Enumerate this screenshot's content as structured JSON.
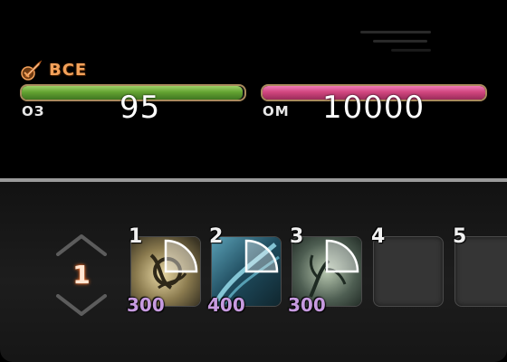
{
  "party_member": {
    "name": "ВСЕ",
    "hp_label": "ОЗ",
    "hp_value": "95",
    "hp_fill": 0.99,
    "mp_label": "ОМ",
    "mp_value": "10000",
    "mp_fill": 1.0,
    "role_icon": "sword-job-icon"
  },
  "colors": {
    "hp": "#64a332",
    "mp": "#d1467f",
    "name": "#f3a15a",
    "cost": "#c79be0"
  },
  "hotbar": {
    "bar_number": "1",
    "slots": [
      {
        "key": "1",
        "cost": "300",
        "icon": "aetherial-skill-icon"
      },
      {
        "key": "2",
        "cost": "400",
        "icon": "water-skill-icon"
      },
      {
        "key": "3",
        "cost": "300",
        "icon": "nature-skill-icon"
      },
      {
        "key": "4",
        "cost": "",
        "icon": "empty-slot"
      },
      {
        "key": "5",
        "cost": "",
        "icon": "empty-slot"
      }
    ]
  }
}
